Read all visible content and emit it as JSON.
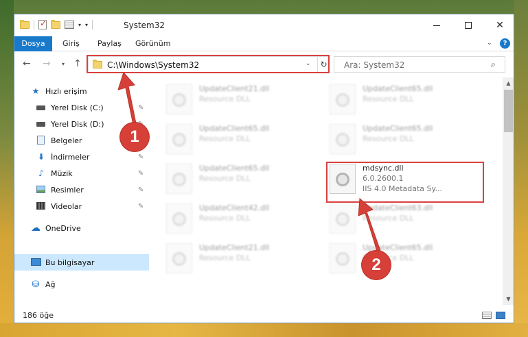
{
  "window": {
    "title": "System32",
    "controls": {
      "minimize": "—",
      "maximize": "☐",
      "close": "✕"
    }
  },
  "ribbon": {
    "tabs": [
      {
        "label": "Dosya"
      },
      {
        "label": "Giriş"
      },
      {
        "label": "Paylaş"
      },
      {
        "label": "Görünüm"
      }
    ],
    "help": "?"
  },
  "address": {
    "path": "C:\\Windows\\System32",
    "search_placeholder": "Ara: System32"
  },
  "sidebar": {
    "items": [
      {
        "label": "Hızlı erişim",
        "icon": "star-icon"
      },
      {
        "label": "Yerel Disk (C:)",
        "icon": "disk-icon",
        "pinned": true
      },
      {
        "label": "Yerel Disk (D:)",
        "icon": "disk-icon",
        "pinned": true
      },
      {
        "label": "Belgeler",
        "icon": "documents-icon",
        "pinned": true
      },
      {
        "label": "İndirmeler",
        "icon": "download-icon",
        "pinned": true
      },
      {
        "label": "Müzik",
        "icon": "music-icon",
        "pinned": true
      },
      {
        "label": "Resimler",
        "icon": "pictures-icon",
        "pinned": true
      },
      {
        "label": "Videolar",
        "icon": "videos-icon",
        "pinned": true
      },
      {
        "label": "OneDrive",
        "icon": "cloud-icon"
      },
      {
        "label": "Bu bilgisayar",
        "icon": "computer-icon",
        "selected": true
      },
      {
        "label": "Ağ",
        "icon": "network-icon"
      }
    ]
  },
  "files": [
    {
      "name": "UpdateClient21.dll",
      "type": "Resource DLL",
      "blurred": true
    },
    {
      "name": "UpdateClient65.dll",
      "type": "Resource DLL",
      "blurred": true
    },
    {
      "name": "UpdateClient65.dll",
      "type": "Resource DLL",
      "blurred": true
    },
    {
      "name": "UpdateClient65.dll",
      "type": "Resource DLL",
      "blurred": true
    },
    {
      "name": "UpdateClient65.dll",
      "type": "Resource DLL",
      "blurred": true
    },
    {
      "name": "mdsync.dll",
      "version": "6.0.2600.1",
      "description": "IIS 4.0 Metadata Sy...",
      "blurred": false
    },
    {
      "name": "UpdateClient42.dll",
      "type": "Resource DLL",
      "blurred": true
    },
    {
      "name": "UpdateClient63.dll",
      "type": "Resource DLL",
      "blurred": true
    },
    {
      "name": "UpdateClient21.dll",
      "type": "Resource DLL",
      "blurred": true
    },
    {
      "name": "UpdateClient65.dll",
      "type": "Resource DLL",
      "blurred": true
    }
  ],
  "status": {
    "item_count": "186 öğe"
  },
  "annotations": {
    "step1": "1",
    "step2": "2",
    "color": "#d64038"
  }
}
